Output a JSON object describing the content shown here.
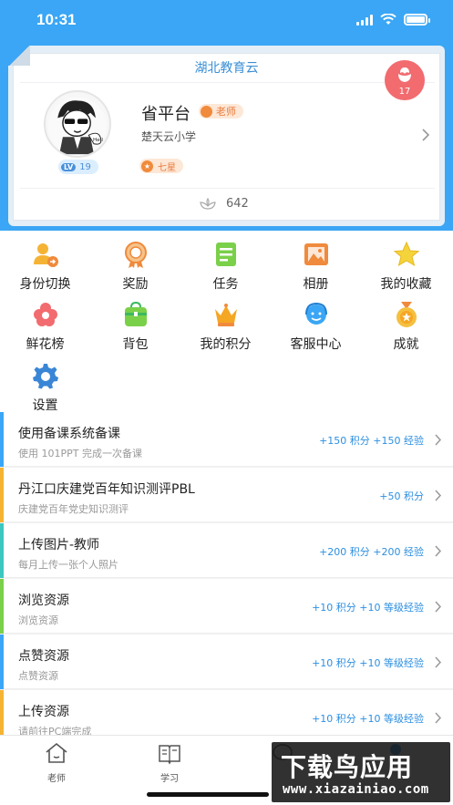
{
  "status_bar": {
    "time": "10:31"
  },
  "profile": {
    "platform_title": "湖北教育云",
    "name": "省平台",
    "role": "老师",
    "school": "楚天云小学",
    "level_prefix": "LV",
    "level": "19",
    "star_rank": "七星",
    "flower_count": "642",
    "rose_count": "17"
  },
  "menu": {
    "items": [
      {
        "label": "身份切换",
        "icon": "identity-switch-icon"
      },
      {
        "label": "奖励",
        "icon": "reward-medal-icon"
      },
      {
        "label": "任务",
        "icon": "task-list-icon"
      },
      {
        "label": "相册",
        "icon": "photo-album-icon"
      },
      {
        "label": "我的收藏",
        "icon": "star-icon"
      },
      {
        "label": "鲜花榜",
        "icon": "flower-icon"
      },
      {
        "label": "背包",
        "icon": "backpack-icon"
      },
      {
        "label": "我的积分",
        "icon": "crown-icon"
      },
      {
        "label": "客服中心",
        "icon": "customer-service-icon"
      },
      {
        "label": "成就",
        "icon": "achievement-medal-icon"
      },
      {
        "label": "设置",
        "icon": "gear-icon"
      }
    ]
  },
  "tasks": [
    {
      "title": "使用备课系统备课",
      "subtitle": "使用 101PPT 完成一次备课",
      "reward": "+150 积分 +150 经验",
      "color": "#3aa6f5"
    },
    {
      "title": "丹江口庆建党百年知识测评PBL",
      "subtitle": "庆建党百年党史知识测评",
      "reward": "+50 积分",
      "color": "#f5b335"
    },
    {
      "title": "上传图片-教师",
      "subtitle": "每月上传一张个人照片",
      "reward": "+200 积分 +200 经验",
      "color": "#3cc8c0"
    },
    {
      "title": "浏览资源",
      "subtitle": "浏览资源",
      "reward": "+10 积分 +10 等级经验",
      "color": "#7bd04a"
    },
    {
      "title": "点赞资源",
      "subtitle": "点赞资源",
      "reward": "+10 积分 +10 等级经验",
      "color": "#3aa6f5"
    },
    {
      "title": "上传资源",
      "subtitle": "请前往PC端完成",
      "reward": "+10 积分 +10 等级经验",
      "color": "#f5b335"
    }
  ],
  "tabbar": {
    "tabs": [
      {
        "label": "老师",
        "icon": "home-icon"
      },
      {
        "label": "学习",
        "icon": "book-icon"
      }
    ]
  },
  "watermark": {
    "title": "下载鸟应用",
    "url": "www.xiazainiao.com"
  },
  "colors": {
    "primary": "#3aa6f5",
    "accent": "#f26b6f",
    "reward_text": "#2d8fe0"
  }
}
